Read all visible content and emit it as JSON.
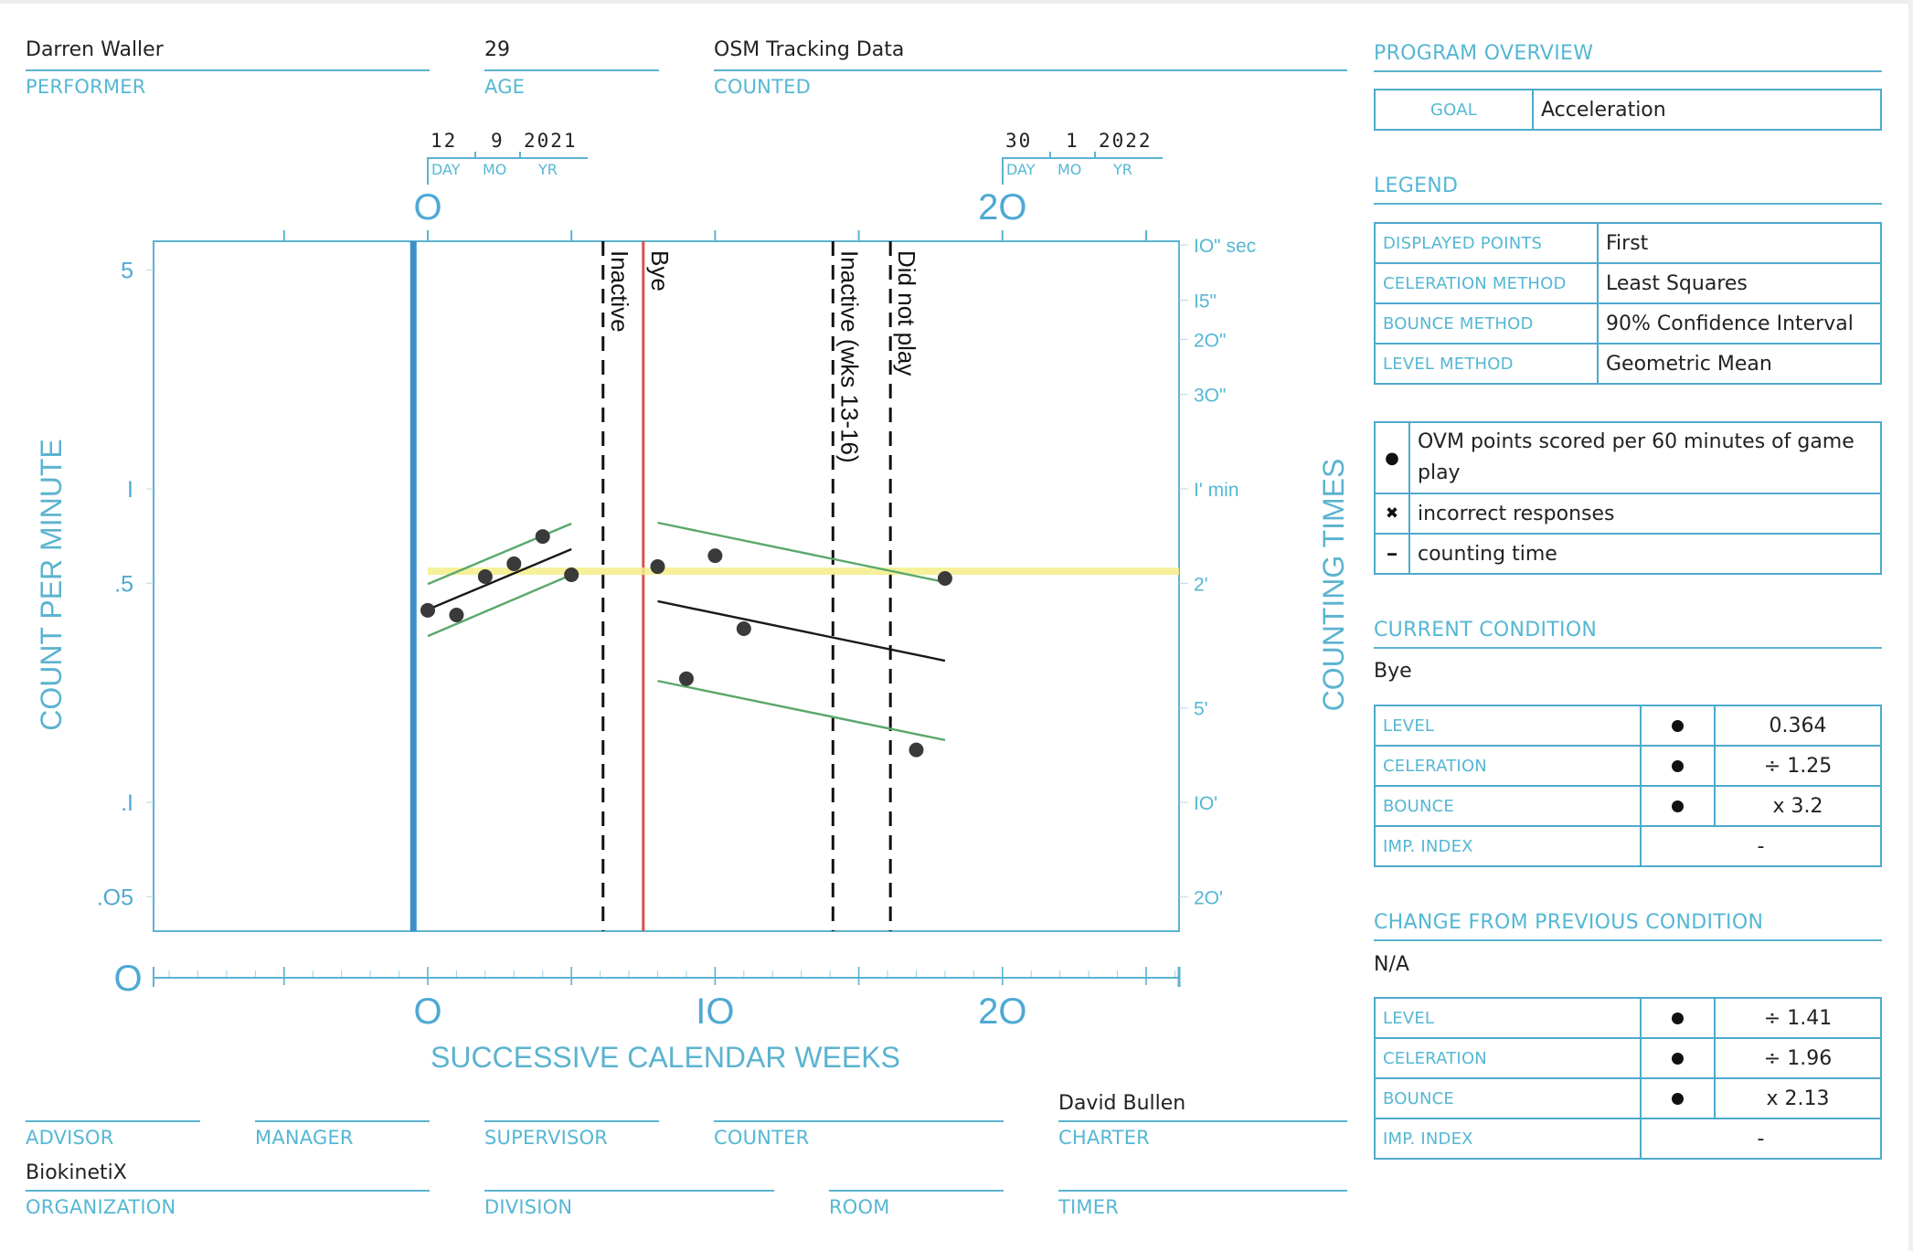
{
  "header": {
    "performer": {
      "value": "Darren Waller",
      "label": "PERFORMER"
    },
    "age": {
      "value": "29",
      "label": "AGE"
    },
    "counted": {
      "value": "OSM Tracking Data",
      "label": "COUNTED"
    }
  },
  "dates": {
    "start": {
      "day": "12",
      "month": "9",
      "year": "2021",
      "day_label": "DAY",
      "month_label": "MO",
      "year_label": "YR",
      "week": 0
    },
    "end": {
      "day": "30",
      "month": "1",
      "year": "2022",
      "day_label": "DAY",
      "month_label": "MO",
      "year_label": "YR",
      "week": 20
    }
  },
  "footer": {
    "advisor": {
      "value": "",
      "label": "ADVISOR"
    },
    "manager": {
      "value": "",
      "label": "MANAGER"
    },
    "supervisor": {
      "value": "",
      "label": "SUPERVISOR"
    },
    "counter": {
      "value": "",
      "label": "COUNTER"
    },
    "charter": {
      "value": "David Bullen",
      "label": "CHARTER"
    },
    "organization": {
      "value": "BiokinetiX",
      "label": "ORGANIZATION"
    },
    "division": {
      "value": "",
      "label": "DIVISION"
    },
    "room": {
      "value": "",
      "label": "ROOM"
    },
    "timer": {
      "value": "",
      "label": "TIMER"
    }
  },
  "program_overview": {
    "title": "PROGRAM OVERVIEW",
    "goal_label": "GOAL",
    "goal_value": "Acceleration"
  },
  "legend": {
    "title": "LEGEND",
    "rows": [
      {
        "label": "DISPLAYED POINTS",
        "value": "First"
      },
      {
        "label": "CELERATION METHOD",
        "value": "Least Squares"
      },
      {
        "label": "BOUNCE METHOD",
        "value": "90% Confidence Interval"
      },
      {
        "label": "LEVEL METHOD",
        "value": "Geometric Mean"
      }
    ],
    "symbols": [
      {
        "icon": "filled-dot-icon",
        "glyph": "●",
        "text": "OVM points scored per 60 minutes of game play"
      },
      {
        "icon": "x-mark-icon",
        "glyph": "✖",
        "text": "incorrect responses"
      },
      {
        "icon": "dash-icon",
        "glyph": "━",
        "text": "counting time"
      }
    ]
  },
  "current_condition": {
    "title": "CURRENT CONDITION",
    "name": "Bye",
    "rows": [
      {
        "label": "LEVEL",
        "value": "0.364"
      },
      {
        "label": "CELERATION",
        "value": "÷ 1.25"
      },
      {
        "label": "BOUNCE",
        "value": "x 3.2"
      },
      {
        "label": "IMP. INDEX",
        "value": "-"
      }
    ]
  },
  "change_condition": {
    "title": "CHANGE FROM PREVIOUS CONDITION",
    "name": "N/A",
    "rows": [
      {
        "label": "LEVEL",
        "value": "÷ 1.41"
      },
      {
        "label": "CELERATION",
        "value": "÷ 1.96"
      },
      {
        "label": "BOUNCE",
        "value": "x 2.13"
      },
      {
        "label": "IMP. INDEX",
        "value": "-"
      }
    ]
  },
  "colors": {
    "axis": "#5bb3d0",
    "phase_line": "#3d8fc9",
    "bye_line": "#d9534f",
    "aim_band": "#f5ee8a",
    "bounce_lines": "#5aa86a",
    "trend_line": "#1a1a1a",
    "points": "#3a3a3a"
  },
  "chart_data": {
    "type": "scatter",
    "title": "",
    "xlabel": "SUCCESSIVE CALENDAR WEEKS",
    "ylabel": "COUNT PER MINUTE",
    "y2label": "COUNTING TIMES",
    "yscale": "log",
    "xlim": [
      -9.6,
      26.1
    ],
    "ylim": [
      0.03,
      7
    ],
    "x_tick_labels": [
      {
        "x": 0,
        "label": "O"
      },
      {
        "x": 10,
        "label": "IO"
      },
      {
        "x": 20,
        "label": "2O"
      }
    ],
    "top_tick_labels": [
      {
        "x": 0,
        "label": "O"
      },
      {
        "x": 20,
        "label": "2O"
      }
    ],
    "x_origin_label": "O",
    "y_tick_labels": [
      {
        "y": 5,
        "label": "5"
      },
      {
        "y": 1,
        "label": "I"
      },
      {
        "y": 0.5,
        "label": ".5"
      },
      {
        "y": 0.1,
        "label": ".I"
      },
      {
        "y": 0.05,
        "label": ".O5"
      }
    ],
    "y2_tick_labels": [
      {
        "y": 6,
        "label": "IO\" sec"
      },
      {
        "y": 4,
        "label": "I5\""
      },
      {
        "y": 3,
        "label": "2O\""
      },
      {
        "y": 2,
        "label": "3O\""
      },
      {
        "y": 1,
        "label": "I' min"
      },
      {
        "y": 0.5,
        "label": "2'"
      },
      {
        "y": 0.2,
        "label": "5'"
      },
      {
        "y": 0.1,
        "label": "IO'"
      },
      {
        "y": 0.05,
        "label": "2O'"
      }
    ],
    "series": [
      {
        "name": "OVM points scored per 60 minutes of game play",
        "marker": "dot",
        "points": [
          {
            "x": 0,
            "y": 0.41
          },
          {
            "x": 1,
            "y": 0.396
          },
          {
            "x": 2,
            "y": 0.525
          },
          {
            "x": 3,
            "y": 0.577
          },
          {
            "x": 4,
            "y": 0.705
          },
          {
            "x": 5,
            "y": 0.532
          },
          {
            "x": 8,
            "y": 0.565
          },
          {
            "x": 9,
            "y": 0.248
          },
          {
            "x": 10,
            "y": 0.612
          },
          {
            "x": 11,
            "y": 0.358
          },
          {
            "x": 17,
            "y": 0.147
          },
          {
            "x": 18,
            "y": 0.518
          }
        ]
      }
    ],
    "trend_lines": [
      {
        "name": "celeration-phase-1",
        "kind": "celeration",
        "x": [
          0,
          5
        ],
        "y": [
          0.412,
          0.642
        ]
      },
      {
        "name": "bounce-upper-phase-1",
        "kind": "bounce",
        "x": [
          0,
          5
        ],
        "y": [
          0.497,
          0.775
        ]
      },
      {
        "name": "bounce-lower-phase-1",
        "kind": "bounce",
        "x": [
          0,
          5
        ],
        "y": [
          0.339,
          0.532
        ]
      },
      {
        "name": "celeration-phase-2",
        "kind": "celeration",
        "x": [
          8,
          18
        ],
        "y": [
          0.438,
          0.283
        ]
      },
      {
        "name": "bounce-upper-phase-2",
        "kind": "bounce",
        "x": [
          8,
          18
        ],
        "y": [
          0.78,
          0.504
        ]
      },
      {
        "name": "bounce-lower-phase-2",
        "kind": "bounce",
        "x": [
          8,
          18
        ],
        "y": [
          0.244,
          0.158
        ]
      }
    ],
    "aim_band": {
      "y": 0.546,
      "x_start": 0
    },
    "phase_lines": [
      {
        "x": -0.5,
        "style": "solid-blue",
        "label": ""
      },
      {
        "x": 6.1,
        "style": "dashed",
        "label": "Inactive"
      },
      {
        "x": 7.5,
        "style": "solid-red",
        "label": "Bye"
      },
      {
        "x": 14.1,
        "style": "dashed",
        "label": "Inactive (wks 13-16)"
      },
      {
        "x": 16.1,
        "style": "dashed",
        "label": "Did not play"
      }
    ],
    "grid": false
  }
}
